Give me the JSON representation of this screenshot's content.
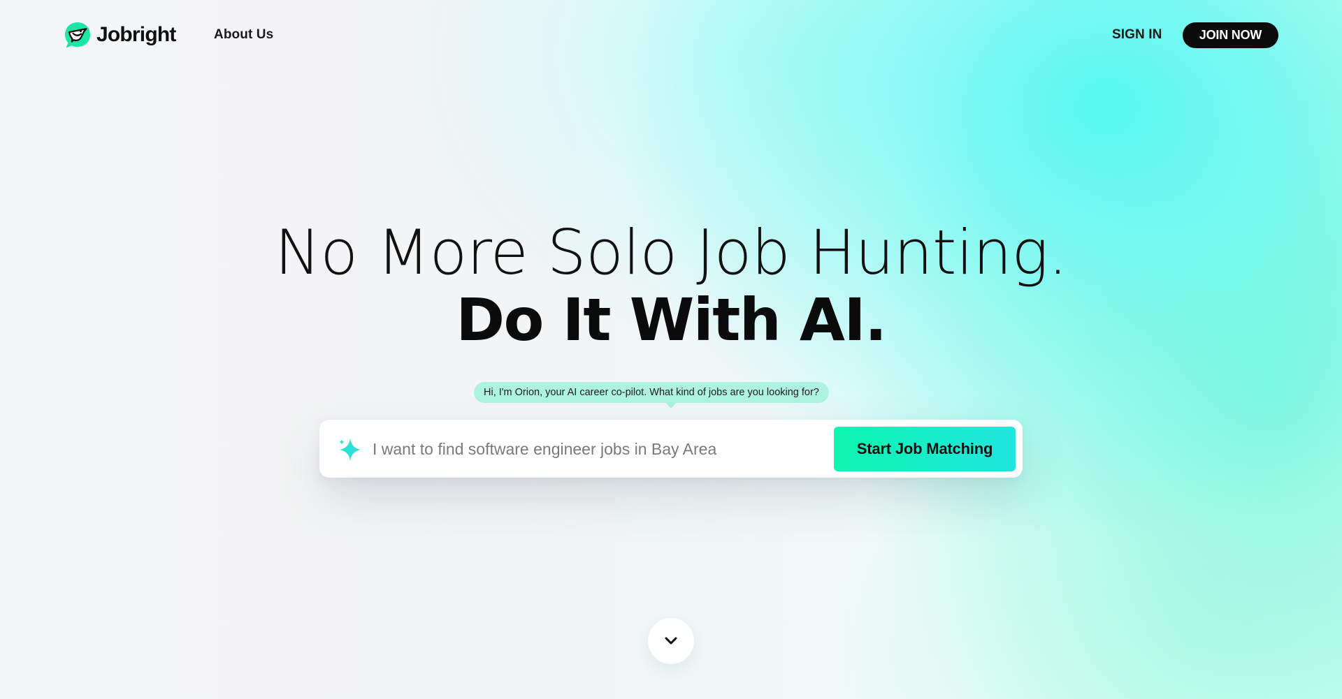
{
  "brand": {
    "name": "Jobright",
    "logo_icon": "bird-chat-logo-icon",
    "accent_color": "#1ee8b0"
  },
  "nav": {
    "about_label": "About Us",
    "sign_in_label": "SIGN IN",
    "join_label": "JOIN NOW"
  },
  "hero": {
    "line1": "No More Solo Job Hunting.",
    "line2": "Do It With AI."
  },
  "assistant": {
    "greeting": "Hi, I'm Orion, your AI career co-pilot. What kind of jobs are you looking for?"
  },
  "search": {
    "placeholder": "I want to find software engineer jobs in Bay Area",
    "icon": "sparkle-icon",
    "button_label": "Start Job Matching"
  },
  "scroll": {
    "icon": "chevron-down-icon"
  }
}
